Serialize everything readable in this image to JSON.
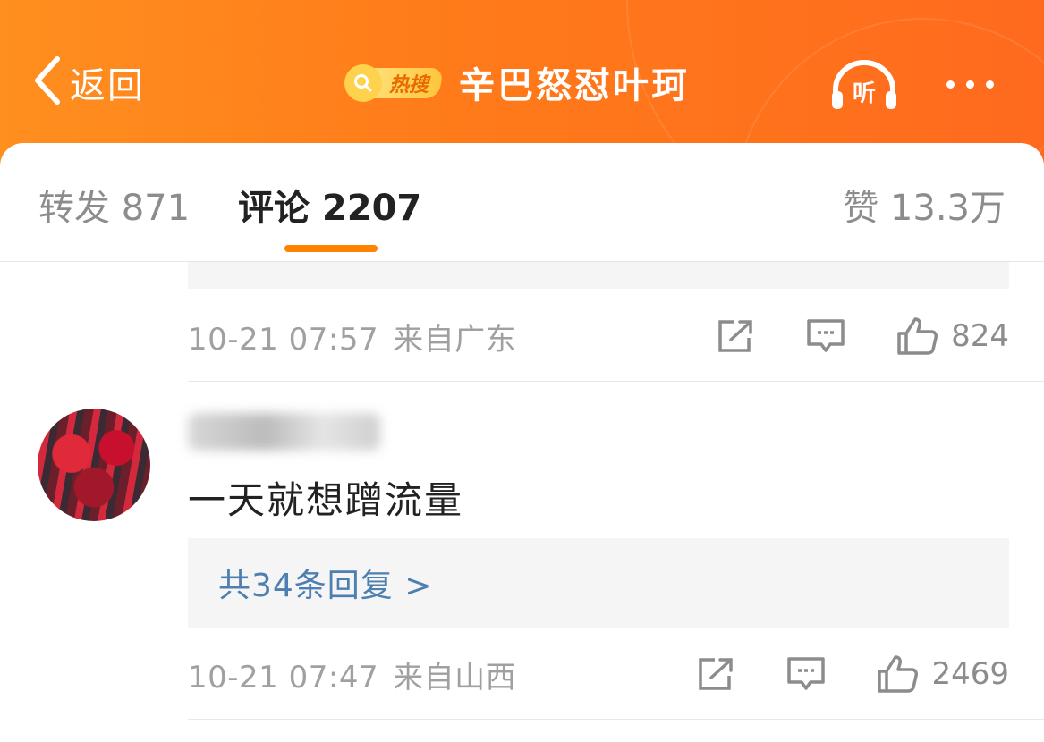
{
  "header": {
    "back_label": "返回",
    "hot_badge_label": "热搜",
    "title": "辛巴怒怼叶珂",
    "listen_label": "听"
  },
  "tabs": {
    "repost": "转发 871",
    "comment": "评论 2207",
    "like": "赞 13.3万"
  },
  "comments": [
    {
      "time": "10-21 07:57",
      "source": "来自广东",
      "likes": "824"
    },
    {
      "text": "一天就想蹭流量",
      "reply_summary": "共34条回复 >",
      "time": "10-21 07:47",
      "source": "来自山西",
      "likes": "2469"
    }
  ],
  "colors": {
    "header_orange": "#ff7a1a",
    "tab_indicator": "#ff8200",
    "reply_link": "#4d7fb0"
  },
  "icons": [
    "chevron-left-icon",
    "search-icon",
    "headphones-icon",
    "more-dots-icon",
    "share-icon",
    "comment-icon",
    "thumbs-up-icon"
  ]
}
